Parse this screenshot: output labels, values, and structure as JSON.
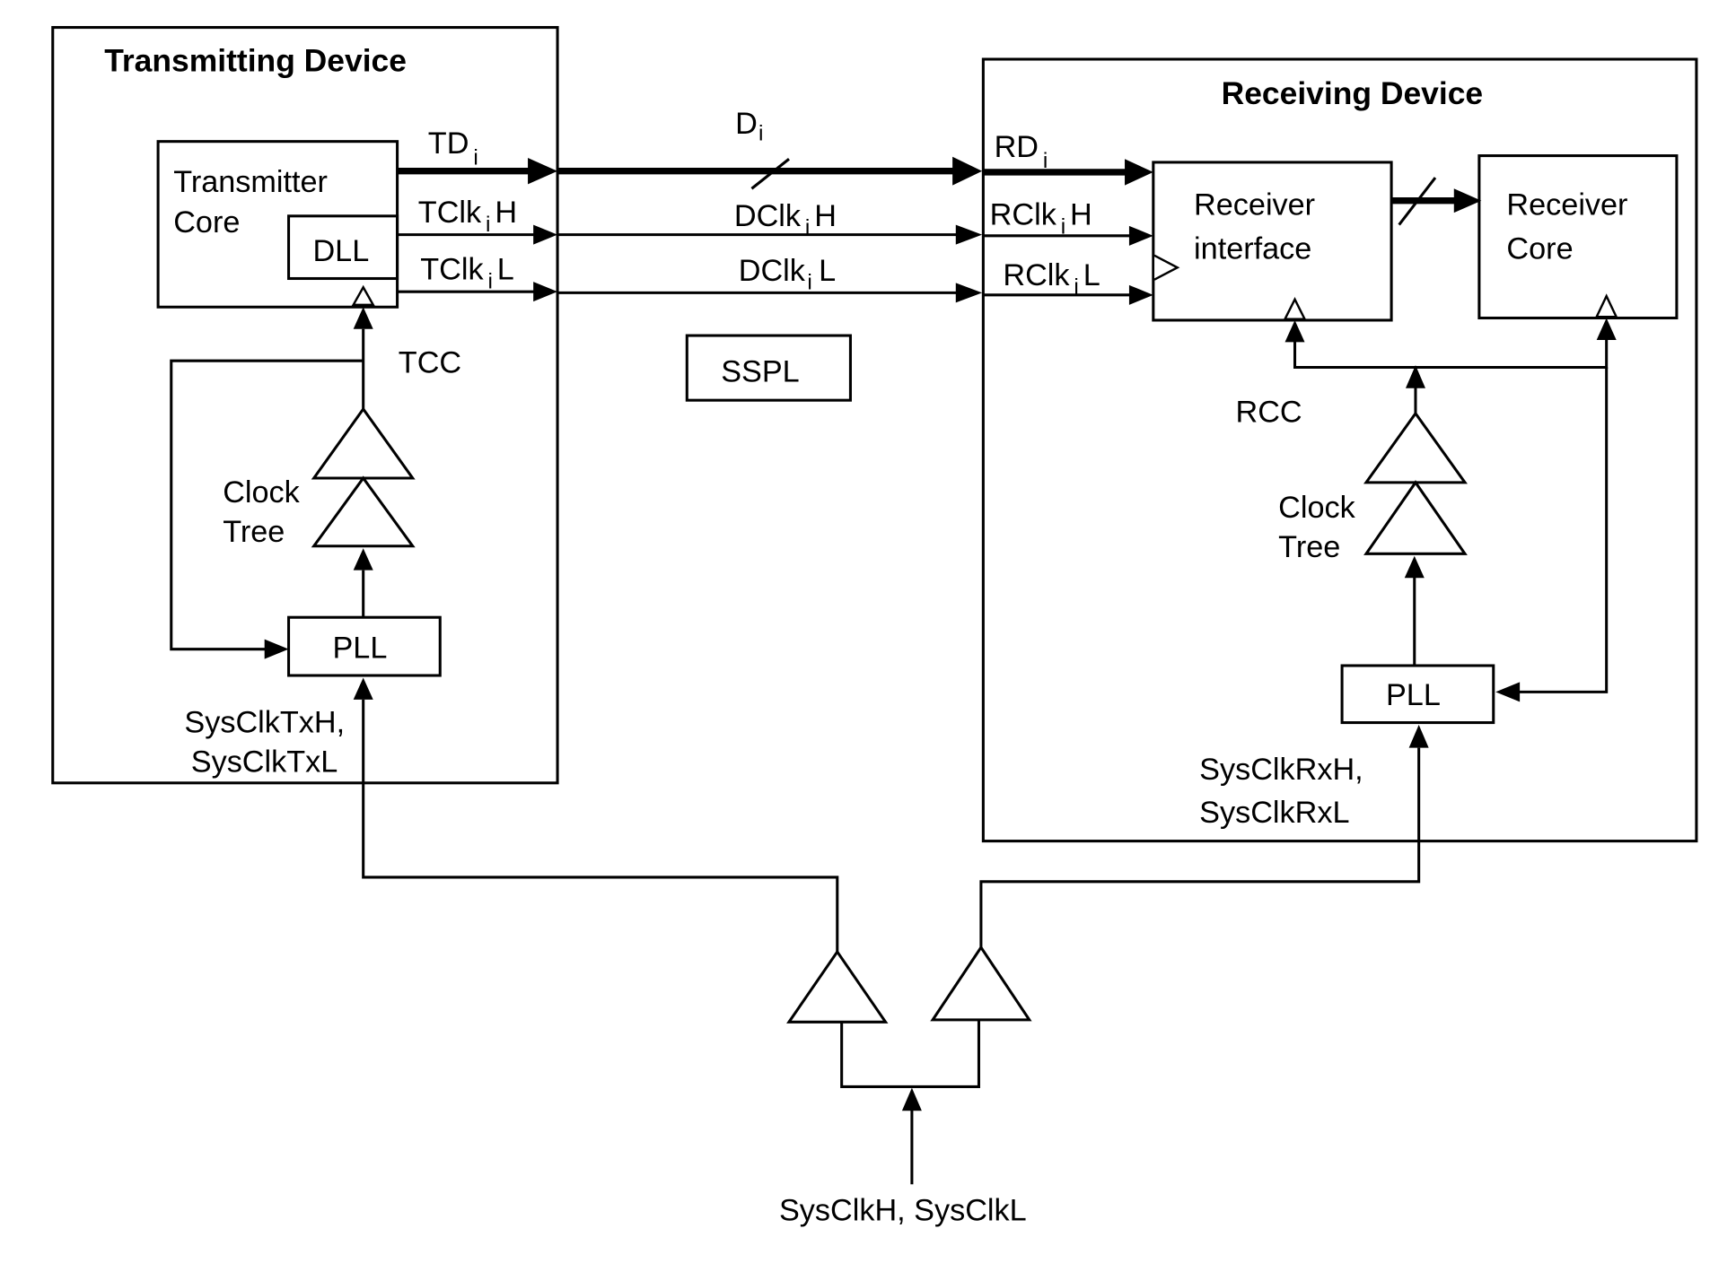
{
  "transmitter": {
    "title": "Transmitting Device",
    "core_label_1": "Transmitter",
    "core_label_2": "Core",
    "dll": "DLL",
    "tcc": "TCC",
    "clock_tree_1": "Clock",
    "clock_tree_2": "Tree",
    "pll": "PLL",
    "sysclk_1": "SysClkTxH,",
    "sysclk_2": "SysClkTxL",
    "signals": {
      "td": "TD",
      "tclk_h_a": "TClk",
      "tclk_h_b": "H",
      "tclk_l_a": "TClk",
      "tclk_l_b": "L",
      "sub": "i"
    }
  },
  "link": {
    "data": "D",
    "dclk_h_a": "DClk",
    "dclk_h_b": "H",
    "dclk_l_a": "DClk",
    "dclk_l_b": "L",
    "sub": "i",
    "sspl": "SSPL"
  },
  "receiver": {
    "title": "Receiving Device",
    "interface_1": "Receiver",
    "interface_2": "interface",
    "core_1": "Receiver",
    "core_2": "Core",
    "rcc": "RCC",
    "clock_tree_1": "Clock",
    "clock_tree_2": "Tree",
    "pll": "PLL",
    "sysclk_1": "SysClkRxH,",
    "sysclk_2": "SysClkRxL",
    "signals": {
      "rd": "RD",
      "rclk_h_a": "RClk",
      "rclk_h_b": "H",
      "rclk_l_a": "RClk",
      "rclk_l_b": "L",
      "sub": "i"
    }
  },
  "system": {
    "sysclk": "SysClkH, SysClkL"
  }
}
